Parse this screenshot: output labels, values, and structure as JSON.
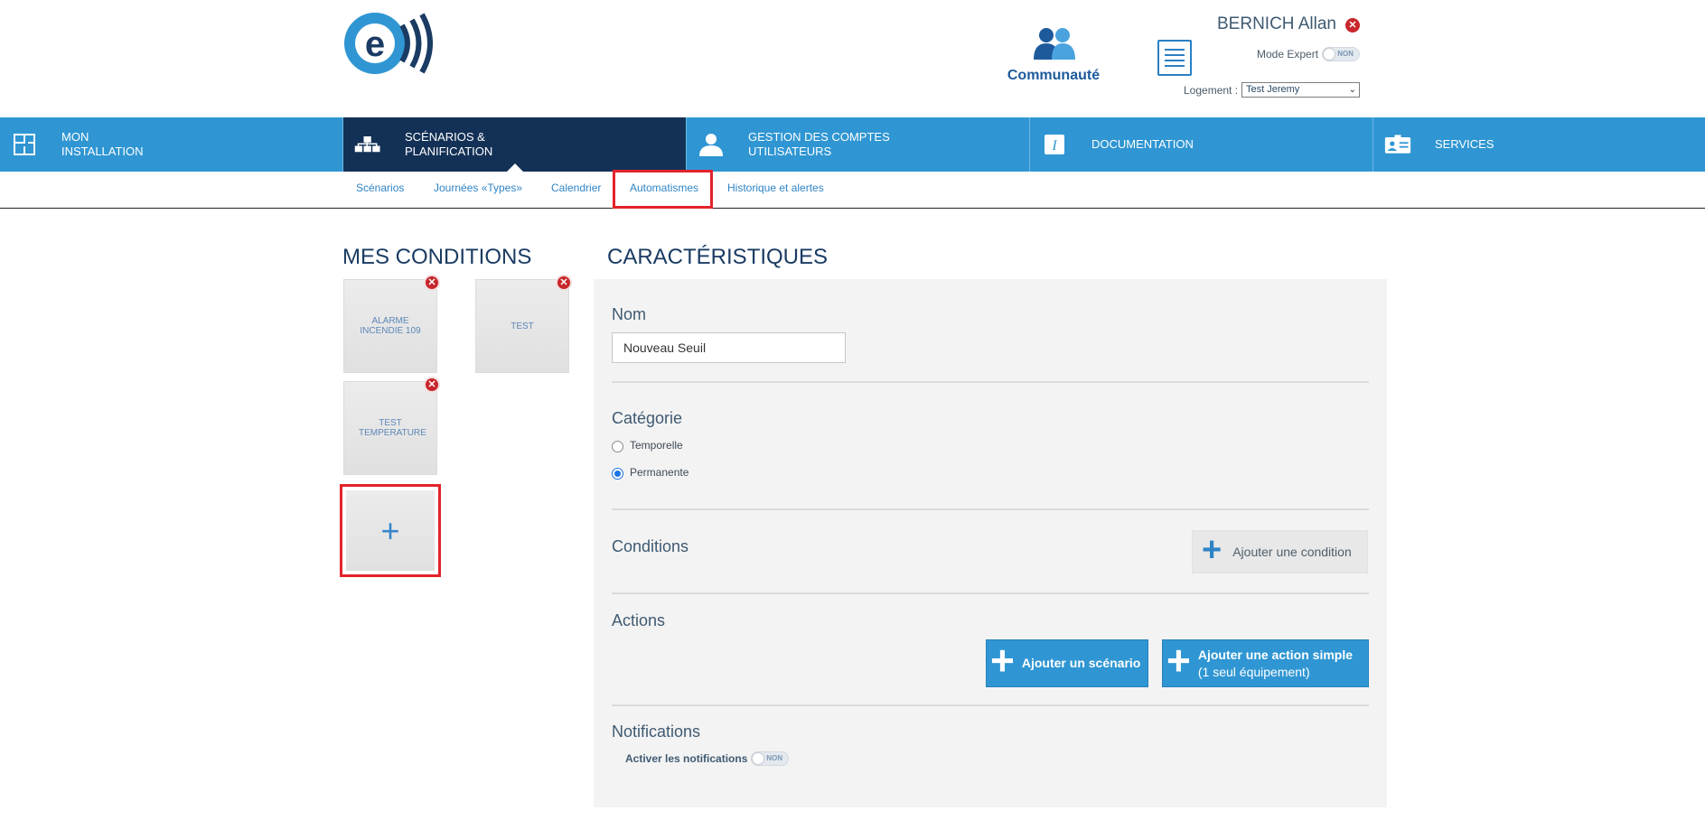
{
  "header": {
    "community_label": "Communauté",
    "user_name": "BERNICH Allan",
    "mode_expert_label": "Mode Expert",
    "mode_expert_state": "NON",
    "logement_label": "Logement :",
    "logement_value": "Test Jeremy"
  },
  "main_nav": [
    {
      "label_line1": "MON",
      "label_line2": "INSTALLATION",
      "icon": "floor-plan-icon"
    },
    {
      "label_line1": "SCÉNARIOS &",
      "label_line2": "PLANIFICATION",
      "icon": "scenario-network-icon"
    },
    {
      "label_line1": "GESTION DES COMPTES",
      "label_line2": "UTILISATEURS",
      "icon": "user-icon"
    },
    {
      "label_line1": "DOCUMENTATION",
      "label_line2": "",
      "icon": "info-icon"
    },
    {
      "label_line1": "SERVICES",
      "label_line2": "",
      "icon": "id-card-icon"
    }
  ],
  "sub_nav": [
    "Scénarios",
    "Journées «Types»",
    "Calendrier",
    "Automatismes",
    "Historique et alertes"
  ],
  "conditions": {
    "title": "MES CONDITIONS",
    "items": [
      "ALARME INCENDIE 109",
      "TEST",
      "TEST TEMPERATURE"
    ],
    "add_symbol": "+"
  },
  "characteristics": {
    "title": "CARACTÉRISTIQUES",
    "name_label": "Nom",
    "name_value": "Nouveau Seuil",
    "category_label": "Catégorie",
    "category_options": [
      "Temporelle",
      "Permanente"
    ],
    "category_selected": "Permanente",
    "conditions_label": "Conditions",
    "add_condition_button": "Ajouter une condition",
    "actions_label": "Actions",
    "add_scenario_button": "Ajouter un scénario",
    "add_simple_action_line1": "Ajouter une action simple",
    "add_simple_action_line2": "(1 seul équipement)",
    "notifications_label": "Notifications",
    "activate_notifications_label": "Activer les notifications",
    "notifications_state": "NON"
  }
}
